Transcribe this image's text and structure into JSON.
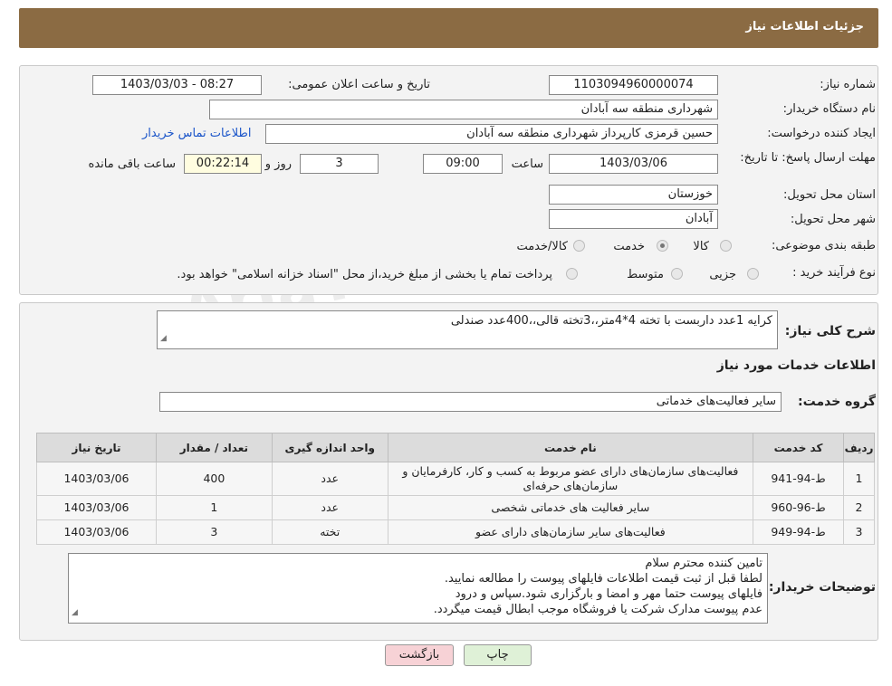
{
  "header": {
    "title": "جزئیات اطلاعات نیاز"
  },
  "form": {
    "need_number_label": "شماره نیاز:",
    "need_number": "1103094960000074",
    "announce_label": "تاریخ و ساعت اعلان عمومی:",
    "announce_value": "1403/03/03 - 08:27",
    "buyer_org_label": "نام دستگاه خریدار:",
    "buyer_org": "شهرداری منطقه سه آبادان",
    "creator_label": "ایجاد کننده درخواست:",
    "creator": "حسین قرمزی کارپرداز شهرداری منطقه سه آبادان",
    "contact_link": "اطلاعات تماس خریدار",
    "deadline_label": "مهلت ارسال پاسخ: تا تاریخ:",
    "deadline_date": "1403/03/06",
    "time_label": "ساعت",
    "deadline_time": "09:00",
    "days": "3",
    "days_label": "روز و",
    "remaining": "00:22:14",
    "remaining_label": "ساعت باقی مانده",
    "province_label": "استان محل تحویل:",
    "province": "خوزستان",
    "city_label": "شهر محل تحویل:",
    "city": "آبادان",
    "category_label": "طبقه بندی موضوعی:",
    "category_options": [
      "کالا",
      "خدمت",
      "کالا/خدمت"
    ],
    "category_selected": "خدمت",
    "process_label": "نوع فرآیند خرید :",
    "process_options": [
      "جزیی",
      "متوسط"
    ],
    "process_note": "پرداخت تمام یا بخشی از مبلغ خرید،از محل \"اسناد خزانه اسلامی\" خواهد بود."
  },
  "details": {
    "summary_label": "شرح کلی نیاز:",
    "summary": "کرایه 1عدد داربست با تخته 4*4متر،،3تخته قالی،،400عدد صندلی",
    "services_heading": "اطلاعات خدمات مورد نیاز",
    "group_label": "گروه خدمت:",
    "group": "سایر فعالیت‌های خدماتی"
  },
  "table": {
    "headers": [
      "ردیف",
      "کد خدمت",
      "نام خدمت",
      "واحد اندازه گیری",
      "تعداد / مقدار",
      "تاریخ نیاز"
    ],
    "rows": [
      [
        "1",
        "ط-94-941",
        "فعالیت‌های سازمان‌های دارای عضو مربوط به کسب و کار، کارفرمایان و سازمان‌های حرفه‌ای",
        "عدد",
        "400",
        "1403/03/06"
      ],
      [
        "2",
        "ط-96-960",
        "سایر فعالیت های خدماتی شخصی",
        "عدد",
        "1",
        "1403/03/06"
      ],
      [
        "3",
        "ط-94-949",
        "فعالیت‌های سایر سازمان‌های دارای عضو",
        "تخته",
        "3",
        "1403/03/06"
      ]
    ]
  },
  "buyer_notes": {
    "label": "توضیحات خریدار:",
    "lines": [
      "تامین کننده محترم سلام",
      "لطفا قبل از ثبت قیمت اطلاعات فایلهای پیوست را مطالعه نمایید.",
      "فایلهای پیوست حتما مهر و امضا و بارگزاری شود.سپاس و درود",
      "عدم پیوست مدارک شرکت یا فروشگاه موجب ابطال قیمت میگردد."
    ]
  },
  "buttons": {
    "print": "چاپ",
    "back": "بازگشت"
  },
  "watermark": "AriaTender.net"
}
